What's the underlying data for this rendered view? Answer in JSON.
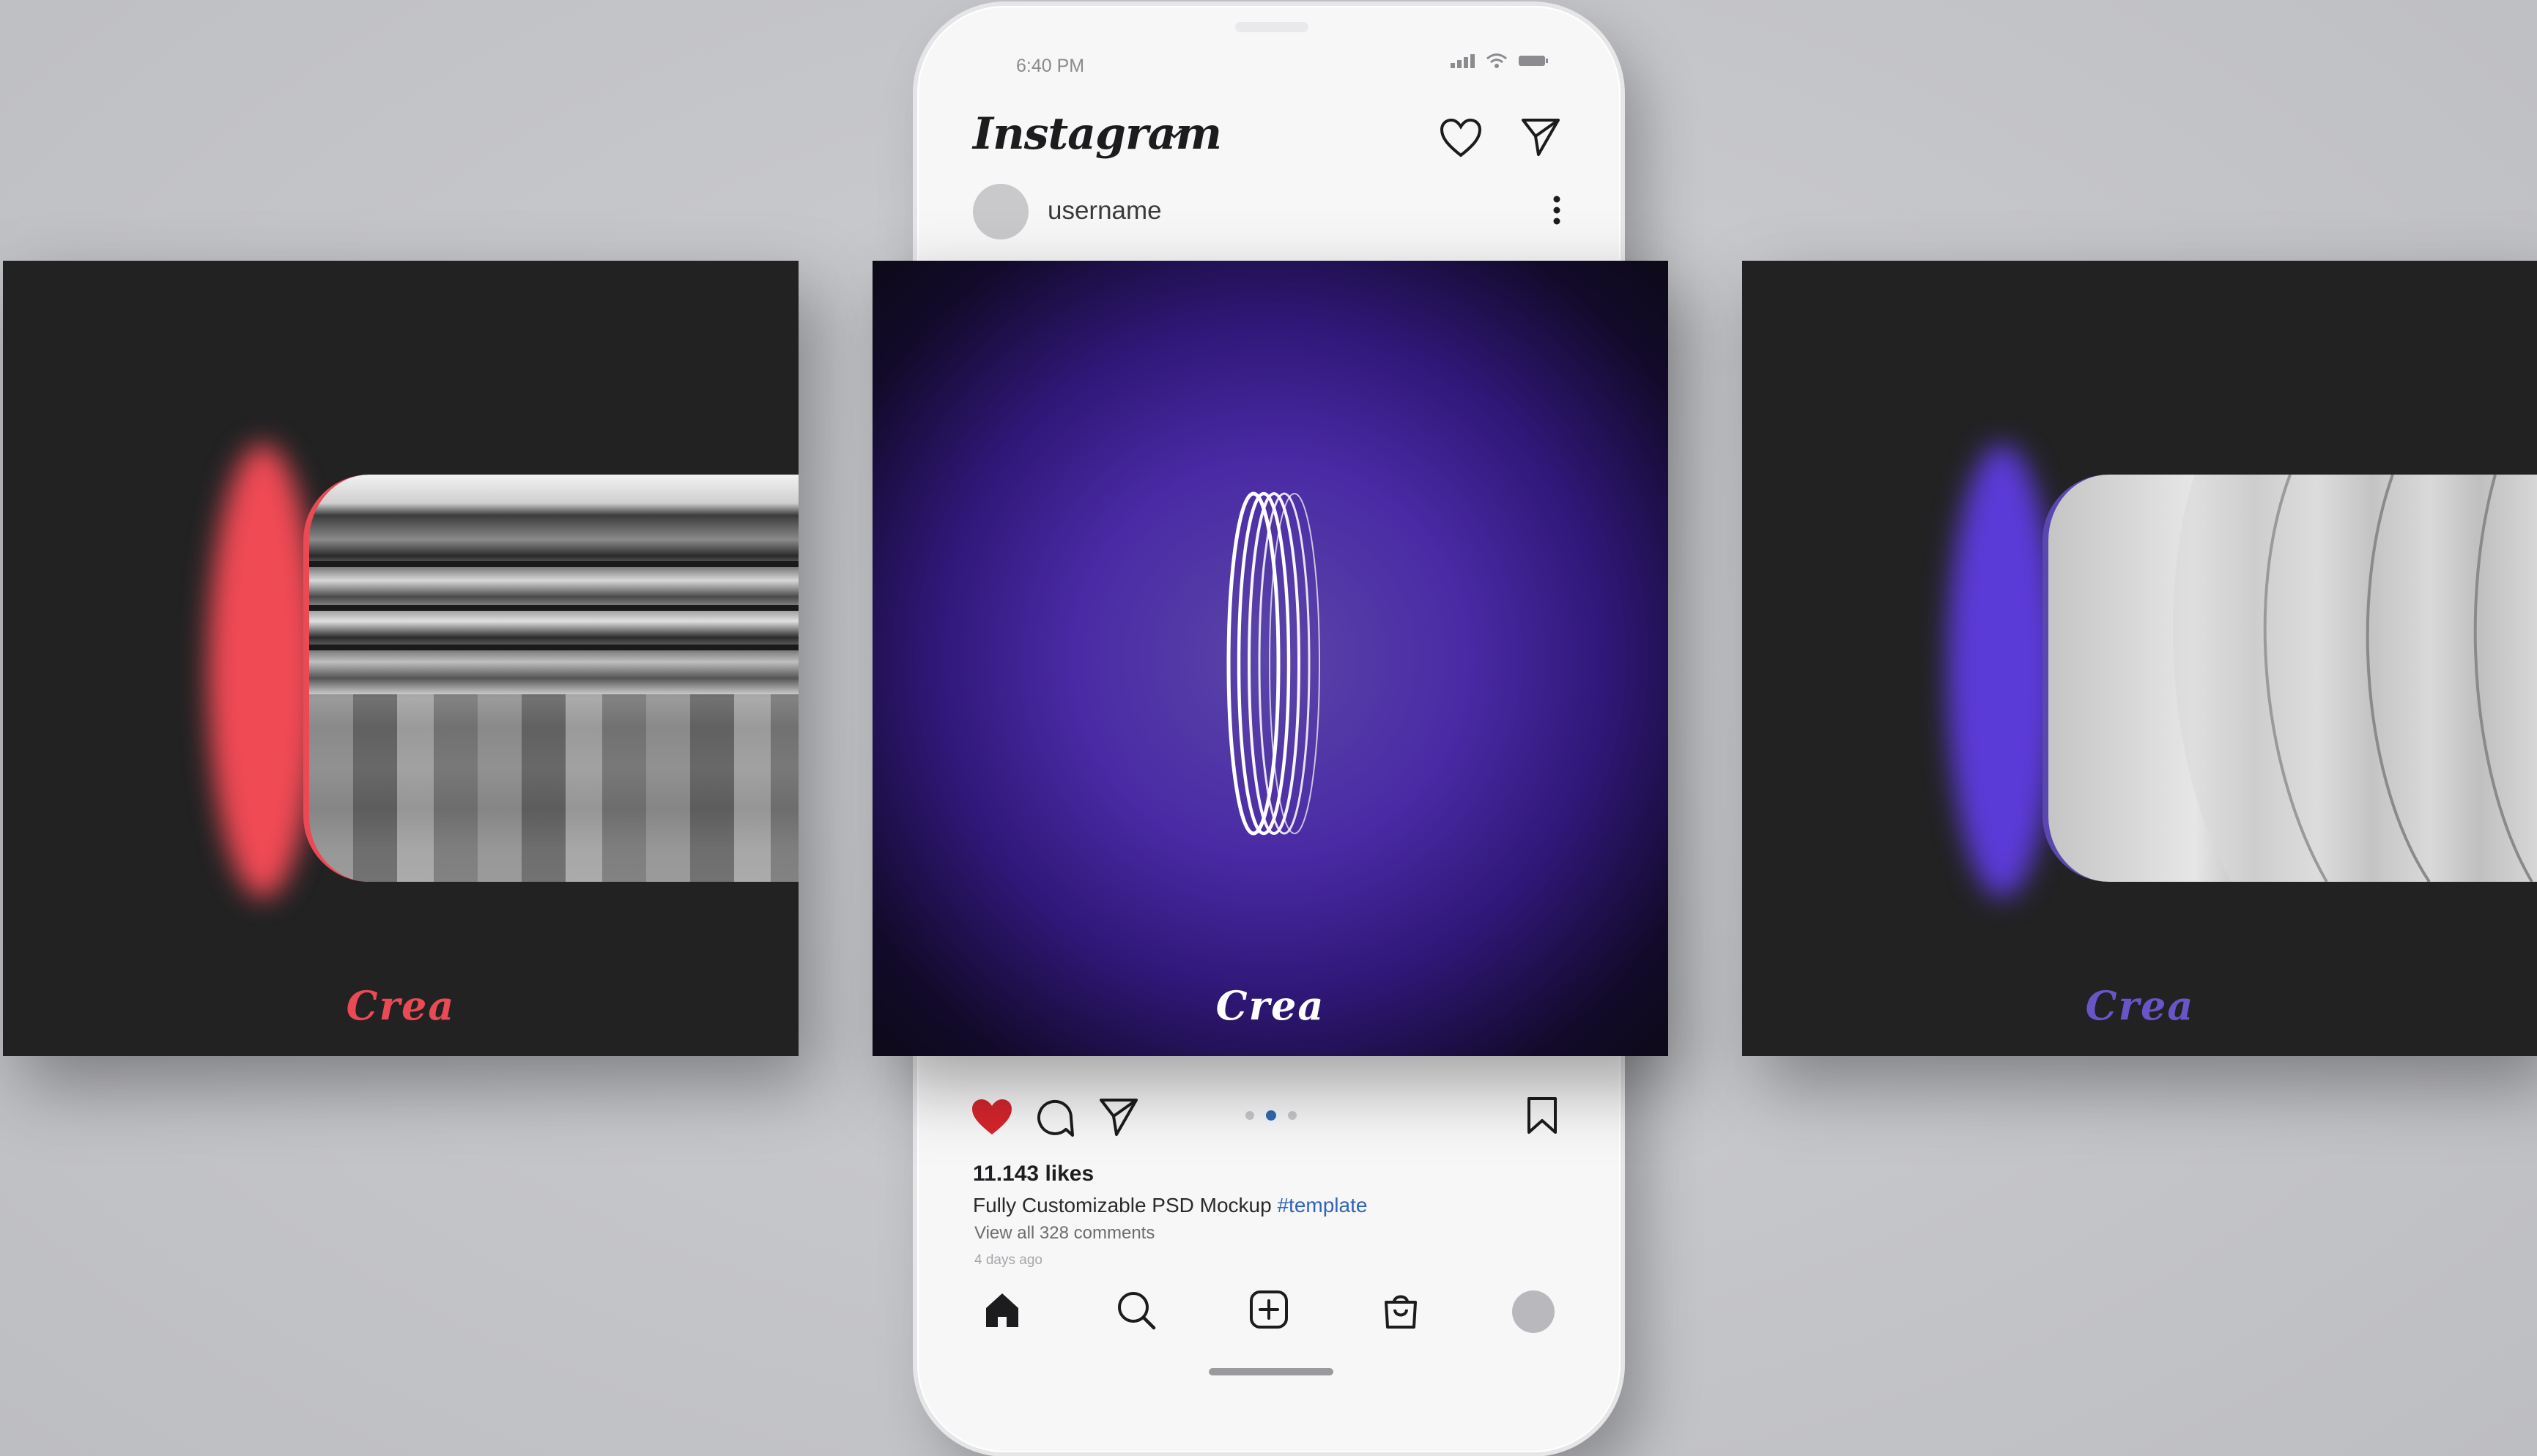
{
  "status_bar": {
    "time": "6:40 PM"
  },
  "header": {
    "app_name": "Instagram"
  },
  "post": {
    "username": "username",
    "likes": "11.143 likes",
    "caption_text": "Fully Customizable PSD Mockup",
    "caption_hashtag": "#template",
    "view_comments": "View all 328 comments",
    "time_ago": "4 days ago",
    "carousel": {
      "count": 3,
      "active_index": 1
    }
  },
  "cards": {
    "left": {
      "brand": "Crea",
      "accent": "#ea4a55"
    },
    "center": {
      "brand": "Crea",
      "accent": "#ffffff"
    },
    "right": {
      "brand": "Crea",
      "accent": "#6a55c8"
    }
  },
  "colors": {
    "like_red": "#d6252d",
    "hashtag_blue": "#2f64b8",
    "background": "#c6c7cb"
  }
}
